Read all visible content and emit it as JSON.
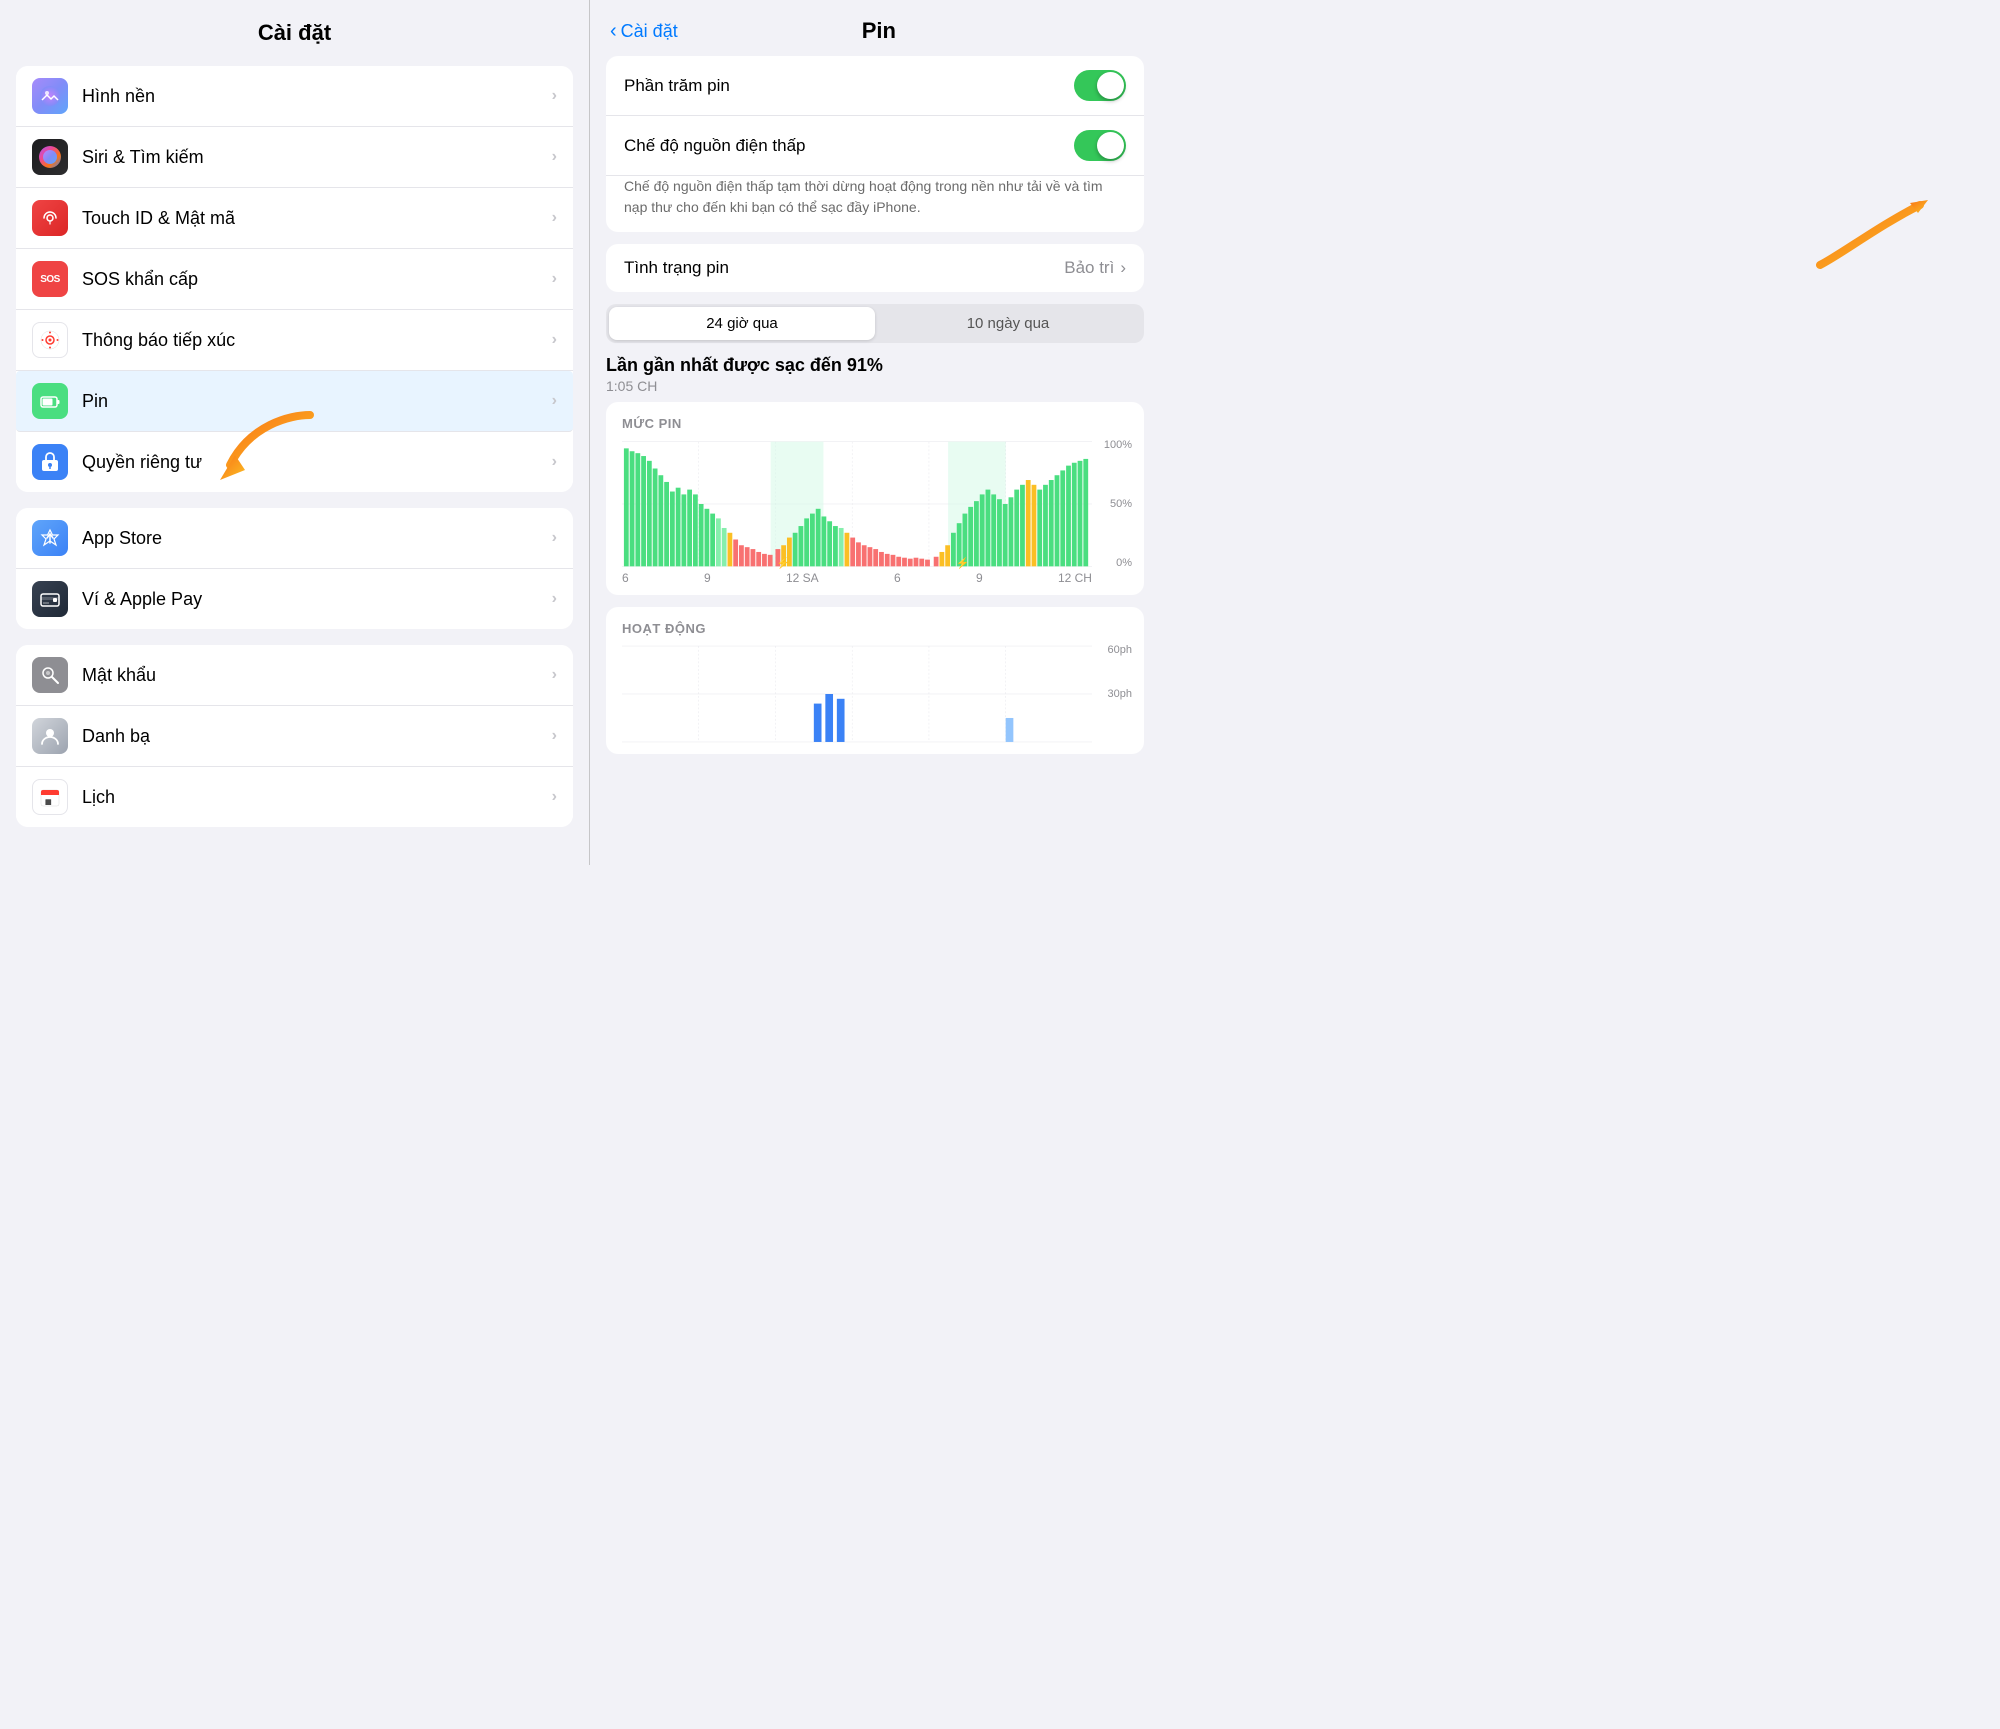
{
  "left": {
    "title": "Cài đặt",
    "groups": [
      {
        "id": "group1",
        "items": [
          {
            "id": "wallpaper",
            "icon": "wallpaper",
            "label": "Hình nền",
            "iconColor": "wallpaper",
            "iconSymbol": "🌸"
          },
          {
            "id": "siri",
            "icon": "siri",
            "label": "Siri & Tìm kiếm",
            "iconColor": "siri",
            "iconSymbol": "◎"
          },
          {
            "id": "touchid",
            "icon": "touchid",
            "label": "Touch ID & Mật mã",
            "iconColor": "touchid",
            "iconSymbol": "👆"
          },
          {
            "id": "sos",
            "icon": "sos",
            "label": "SOS khẩn cấp",
            "iconColor": "sos",
            "iconSymbol": "SOS"
          },
          {
            "id": "contact",
            "icon": "contact",
            "label": "Thông báo tiếp xúc",
            "iconColor": "contact",
            "iconSymbol": "🔴"
          },
          {
            "id": "battery",
            "icon": "battery",
            "label": "Pin",
            "iconColor": "battery",
            "iconSymbol": "🔋",
            "highlighted": true
          },
          {
            "id": "privacy",
            "icon": "privacy",
            "label": "Quyền riêng tư",
            "iconColor": "privacy",
            "iconSymbol": "✋"
          }
        ]
      },
      {
        "id": "group2",
        "items": [
          {
            "id": "appstore",
            "icon": "appstore",
            "label": "App Store",
            "iconColor": "appstore",
            "iconSymbol": "A"
          },
          {
            "id": "wallet",
            "icon": "wallet",
            "label": "Ví & Apple Pay",
            "iconColor": "wallet",
            "iconSymbol": "💳"
          }
        ]
      },
      {
        "id": "group3",
        "items": [
          {
            "id": "passwords",
            "icon": "passwords",
            "label": "Mật khẩu",
            "iconColor": "passwords",
            "iconSymbol": "🗝"
          },
          {
            "id": "contacts",
            "icon": "contacts",
            "label": "Danh bạ",
            "iconColor": "contacts",
            "iconSymbol": "👤"
          },
          {
            "id": "calendar",
            "icon": "calendar",
            "label": "Lịch",
            "iconColor": "calendar",
            "iconSymbol": "📅"
          }
        ]
      }
    ]
  },
  "right": {
    "back_label": "Cài đặt",
    "title": "Pin",
    "sections": {
      "toggles": [
        {
          "id": "percent",
          "label": "Phần trăm pin",
          "enabled": true
        },
        {
          "id": "lowpower",
          "label": "Chế độ nguồn điện thấp",
          "enabled": true
        }
      ],
      "lowpower_description": "Chế độ nguồn điện thấp tạm thời dừng hoạt động trong nền như tải về và tìm nạp thư cho đến khi bạn có thể sạc đầy iPhone.",
      "battery_status": {
        "label": "Tình trạng pin",
        "value": "Bảo trì"
      },
      "tabs": [
        {
          "id": "24h",
          "label": "24 giờ qua",
          "active": true
        },
        {
          "id": "10d",
          "label": "10 ngày qua",
          "active": false
        }
      ],
      "last_charge": {
        "title": "Lần gần nhất được sạc đến 91%",
        "time": "1:05 CH"
      },
      "battery_chart": {
        "label": "MỨC PIN",
        "y_labels": [
          "100%",
          "50%",
          "0%"
        ],
        "x_labels": [
          "6",
          "9",
          "12 SA",
          "6",
          "9",
          "12 CH"
        ]
      },
      "activity_chart": {
        "label": "HOẠT ĐỘNG",
        "y_labels": [
          "60ph",
          "30ph"
        ]
      }
    }
  }
}
